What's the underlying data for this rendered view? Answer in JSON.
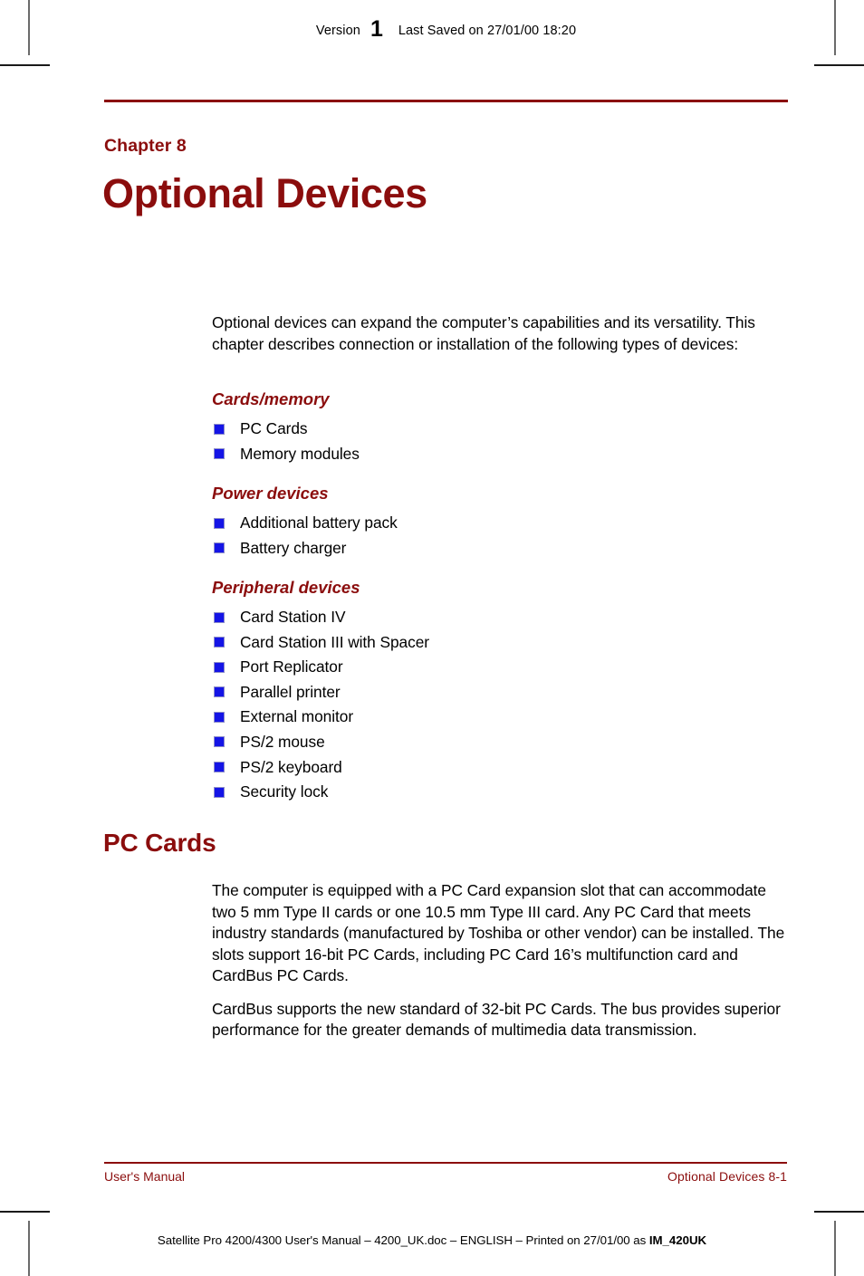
{
  "header": {
    "version_label": "Version",
    "version_number": "1",
    "last_saved": "Last Saved on 27/01/00 18:20"
  },
  "chapter": {
    "label": "Chapter 8",
    "title": "Optional Devices"
  },
  "intro": {
    "paragraph": "Optional devices can expand the computer’s capabilities and its versatility. This chapter describes connection or installation of the following types of devices:"
  },
  "groups": [
    {
      "heading": "Cards/memory",
      "items": [
        "PC Cards",
        "Memory modules"
      ]
    },
    {
      "heading": "Power devices",
      "items": [
        "Additional battery pack",
        "Battery charger"
      ]
    },
    {
      "heading": "Peripheral devices",
      "items": [
        "Card Station IV",
        "Card Station III with Spacer",
        "Port Replicator",
        "Parallel printer",
        "External monitor",
        "PS/2 mouse",
        "PS/2 keyboard",
        "Security lock"
      ]
    }
  ],
  "section": {
    "heading": "PC Cards",
    "paragraphs": [
      "The computer is equipped with a PC Card expansion slot that can accommodate two 5 mm Type II cards or one 10.5 mm Type III card. Any PC Card that meets industry standards (manufactured by Toshiba or other vendor) can be installed. The slots support 16-bit PC Cards, including PC Card 16’s multifunction card and CardBus PC Cards.",
      "CardBus supports the new standard of 32-bit PC Cards. The bus provides superior performance for the greater demands of multimedia data transmission."
    ]
  },
  "footer": {
    "left": "User's Manual",
    "right": "Optional Devices  8-1"
  },
  "print_line": {
    "text": "Satellite Pro 4200/4300 User's Manual  – 4200_UK.doc – ENGLISH – Printed on 27/01/00 as ",
    "doc_code": "IM_420UK"
  },
  "colors": {
    "accent_red": "#8b0d0d",
    "bullet_blue": "#1414e6",
    "text_black": "#000000"
  }
}
